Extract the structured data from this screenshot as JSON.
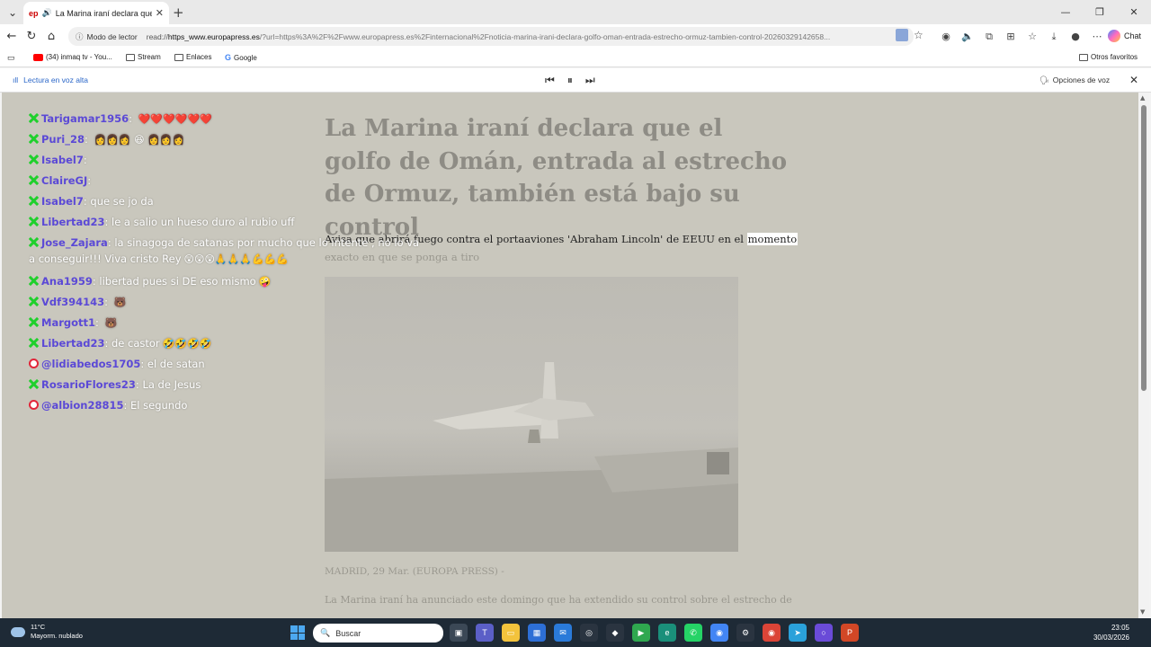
{
  "browser": {
    "tab_title": "La Marina iraní declara que el golfo de Omán",
    "tab_favicon": "ep",
    "reader_label": "Modo de lector",
    "url_prefix": "read://",
    "url_host": "https_www.europapress.es",
    "url_rest": "/?url=https%3A%2F%2Fwww.europapress.es%2Finternacional%2Fnoticia-marina-irani-declara-golfo-oman-entrada-estrecho-ormuz-tambien-control-20260329142658...",
    "chat_label": "Chat"
  },
  "favorites": {
    "items": [
      {
        "label": "(34) inmaq tv - You...",
        "icon": "youtube-icon"
      },
      {
        "label": "Stream",
        "icon": "folder-icon"
      },
      {
        "label": "Enlaces",
        "icon": "folder-icon"
      },
      {
        "label": "Google",
        "icon": "google-icon"
      }
    ],
    "other": "Otros favoritos"
  },
  "readaloud": {
    "label": "Lectura en voz alta",
    "voice_options": "Opciones de voz"
  },
  "article": {
    "headline": "La Marina iraní declara que el golfo de Omán, entrada al estrecho de Ormuz, también está bajo su control",
    "subhead_main": "Avisa que abrirá fuego contra el portaaviones 'Abraham Lincoln' de EEUU en el ",
    "subhead_highlight": "momento",
    "subhead_rest": "exacto en que se ponga a tiro",
    "dateline": "MADRID, 29 Mar. (EUROPA PRESS) -",
    "body_start": "La Marina iraní ha anunciado este domingo que ha extendido su control sobre el estrecho de"
  },
  "chat": [
    {
      "user": "Tarigamar1956",
      "text": "",
      "badge": "x",
      "emoji": "❤️❤️❤️❤️❤️❤️"
    },
    {
      "user": "Puri_28",
      "text": "",
      "badge": "x",
      "emoji": "👩👩👩 😆 👩👩👩"
    },
    {
      "user": "Isabel7",
      "text": "",
      "badge": "x",
      "emoji": ""
    },
    {
      "user": "ClaireGJ",
      "text": "",
      "badge": "x",
      "emoji": ""
    },
    {
      "user": "Isabel7",
      "text": "que se jo da",
      "badge": "x",
      "emoji": ""
    },
    {
      "user": "Libertad23",
      "text": "le a salio un hueso duro al rubio uff",
      "badge": "x",
      "emoji": ""
    },
    {
      "user": "Jose_Zajara",
      "text": "la sinagoga de satanas por mucho que lo intente , no lo va a conseguir!!! Viva cristo Rey",
      "badge": "x",
      "emoji": "😲😲😲🙏🙏🙏💪💪💪"
    },
    {
      "user": "Ana1959",
      "text": "libertad pues si DE eso mismo",
      "badge": "x",
      "emoji": "🤪"
    },
    {
      "user": "Vdf394143",
      "text": "",
      "badge": "x",
      "emoji": "🐻"
    },
    {
      "user": "Margott1",
      "text": "",
      "badge": "x",
      "emoji": "🐻"
    },
    {
      "user": "Libertad23",
      "text": "de castor",
      "badge": "x",
      "emoji": "🤣🤣🤣🤣"
    },
    {
      "user": "@lidiabedos1705",
      "text": "el de satan",
      "badge": "yt",
      "emoji": ""
    },
    {
      "user": "RosarioFlores23",
      "text": "La de Jesus",
      "badge": "x",
      "emoji": ""
    },
    {
      "user": "@albion28815",
      "text": "El segundo",
      "badge": "yt",
      "emoji": ""
    }
  ],
  "taskbar": {
    "temp": "11°C",
    "weather": "Mayorm. nublado",
    "search_placeholder": "Buscar",
    "time": "23:05",
    "date": "30/03/2026"
  }
}
